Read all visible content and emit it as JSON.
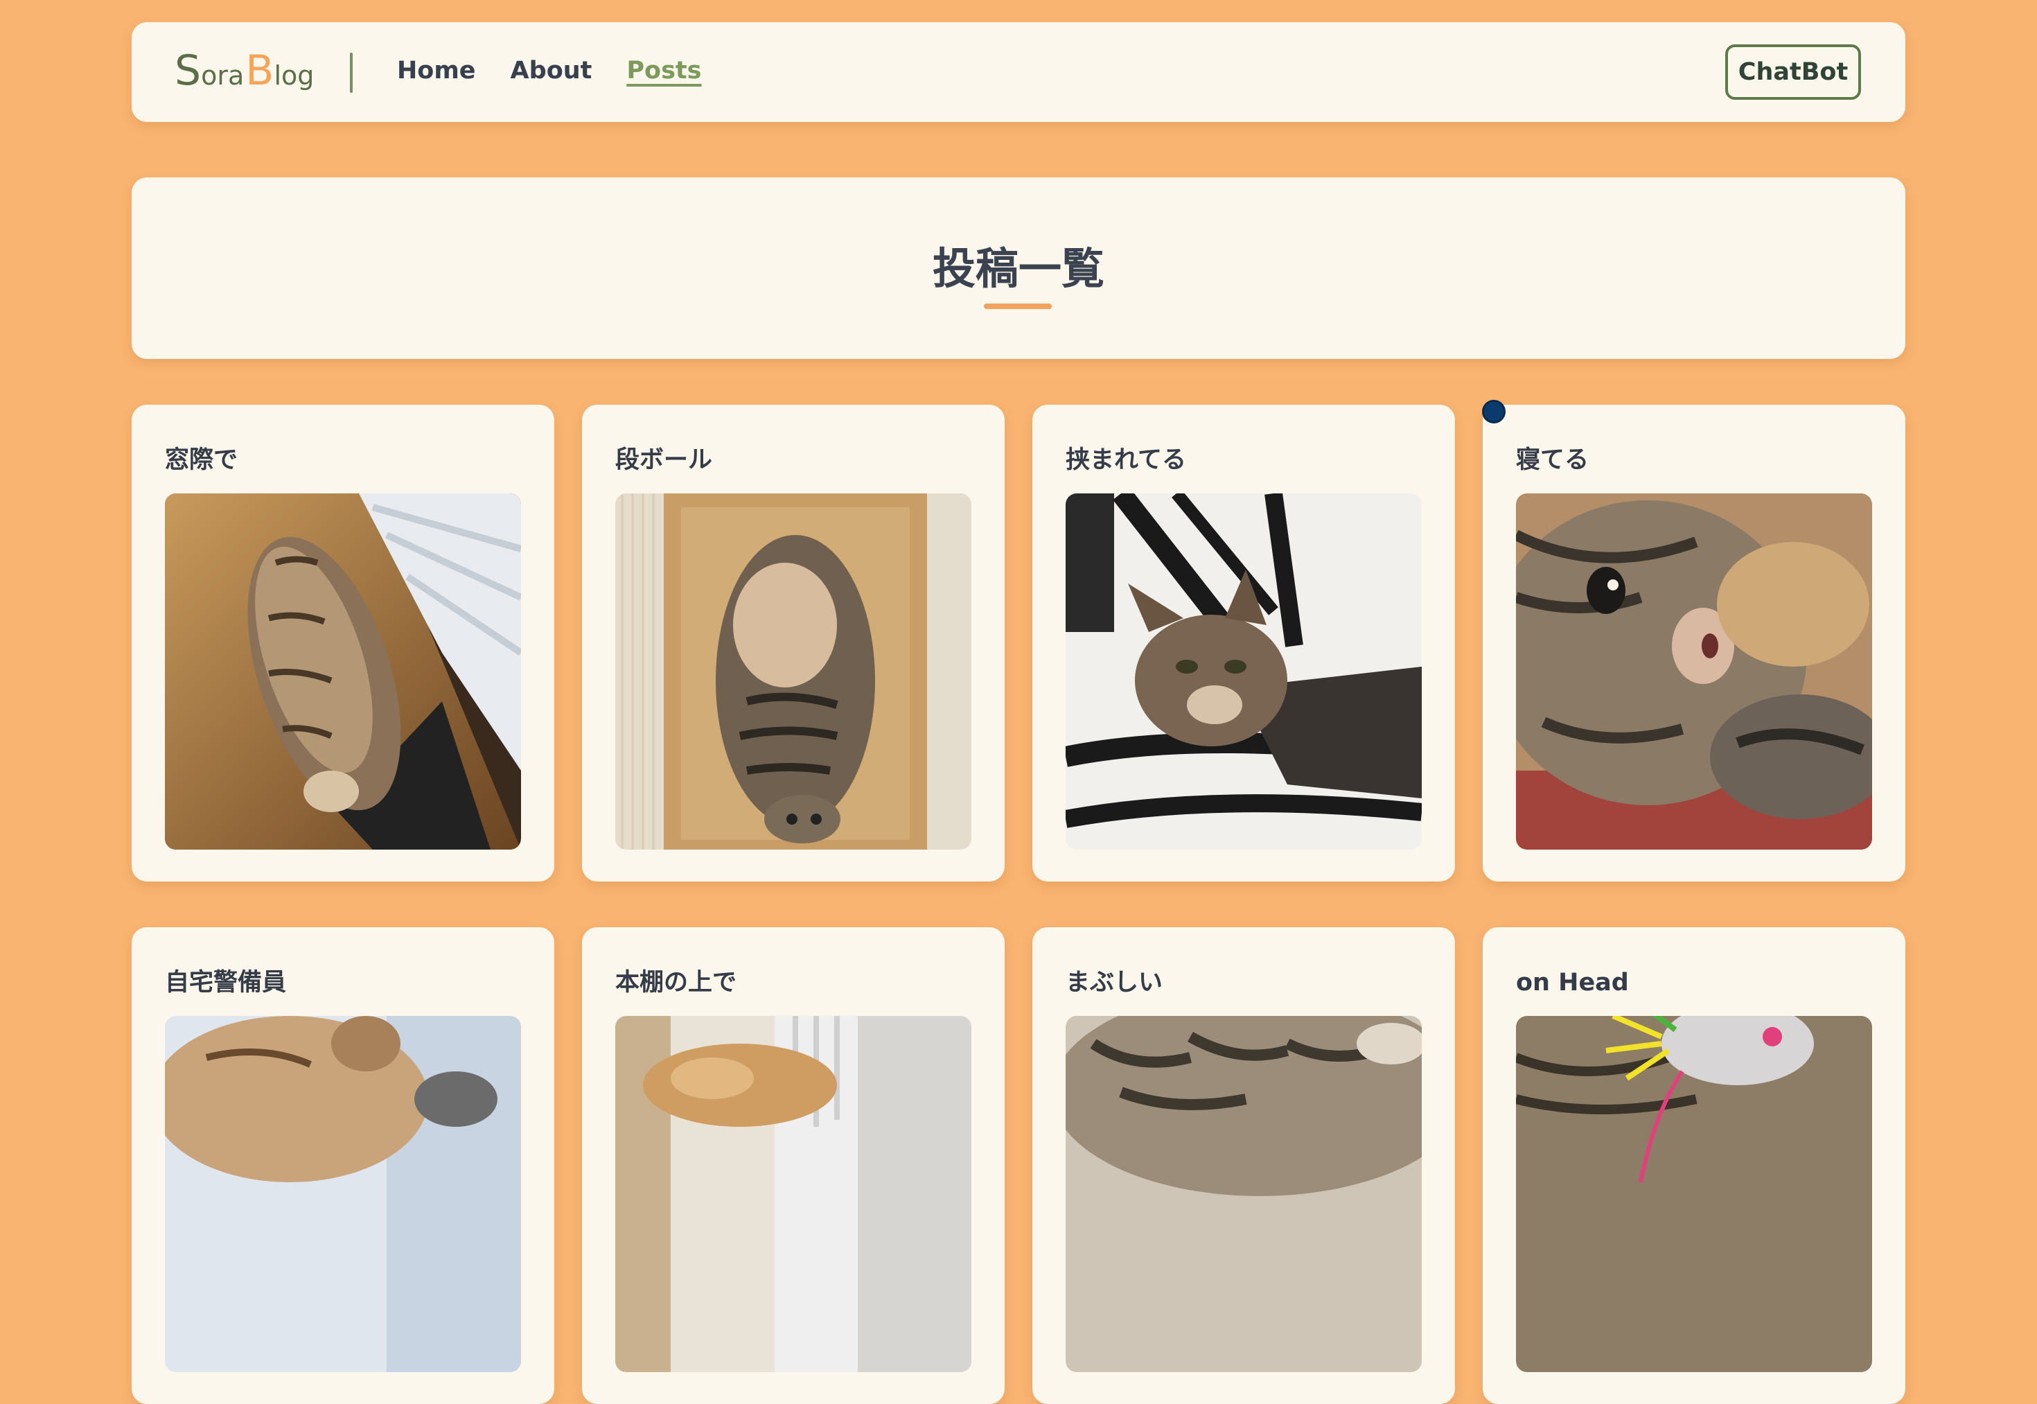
{
  "navbar": {
    "logo": {
      "s": "S",
      "ora": "ora",
      "b": "B",
      "log": "log"
    },
    "links": [
      "Home",
      "About",
      "Posts"
    ],
    "active_link": "Posts",
    "chatbot_label": "ChatBot"
  },
  "page": {
    "title": "投稿一覧"
  },
  "posts": [
    {
      "title": "窓際で",
      "image": "cat-by-window-photo"
    },
    {
      "title": "段ボール",
      "image": "cat-in-cardboard-box-photo"
    },
    {
      "title": "挟まれてる",
      "image": "cat-under-striped-blanket-photo"
    },
    {
      "title": "寝てる",
      "image": "cat-sleeping-closeup-photo"
    },
    {
      "title": "自宅警備員",
      "image": "cat-guard-photo"
    },
    {
      "title": "本棚の上で",
      "image": "cat-on-bookshelf-photo"
    },
    {
      "title": "まぶしい",
      "image": "cat-dazzled-photo"
    },
    {
      "title": "on Head",
      "image": "cat-with-toy-on-head-photo"
    }
  ],
  "colors": {
    "background": "#F9B472",
    "panel": "#FBF7EC",
    "accent": "#F2A15C",
    "logo_green": "#5a6e48",
    "active_link": "#7b9a5c"
  }
}
